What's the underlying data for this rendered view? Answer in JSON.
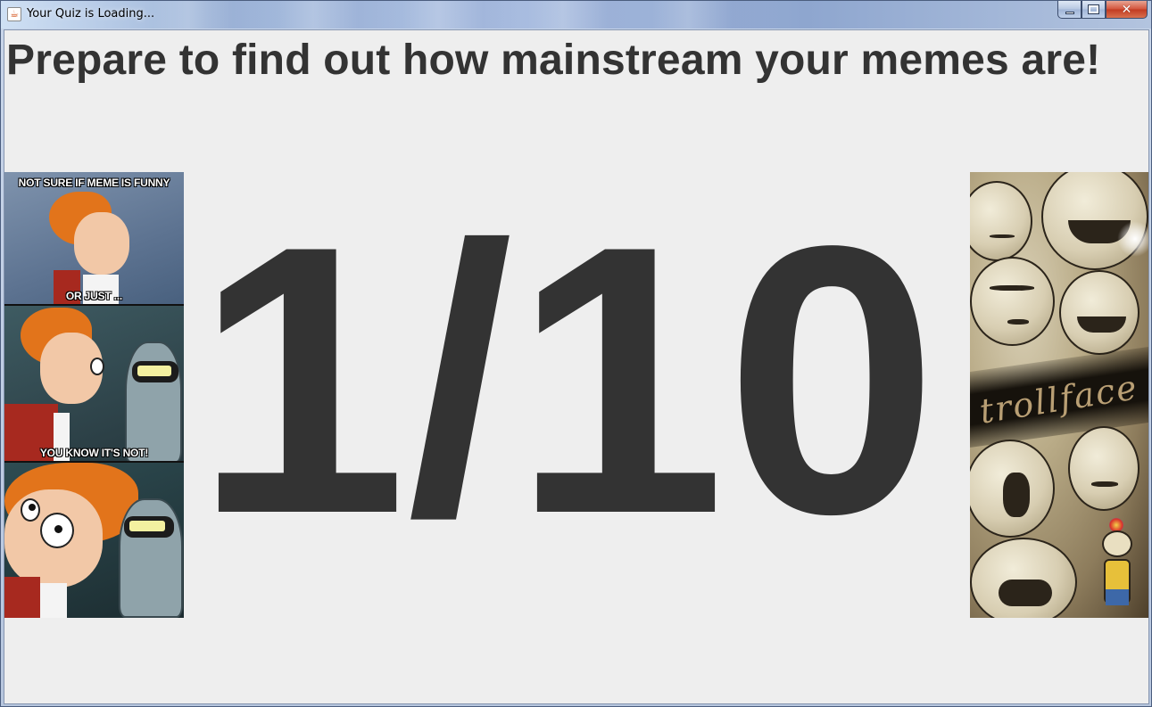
{
  "window": {
    "title": "Your Quiz is Loading...",
    "app_icon": "java-cup-icon",
    "controls": [
      "minimize-icon",
      "maximize-icon",
      "close-icon"
    ]
  },
  "main": {
    "headline": "Prepare to find out how mainstream your memes are!",
    "counter": "1/10"
  },
  "images": {
    "left_meme": {
      "caption_top": "NOT SURE IF MEME IS FUNNY",
      "caption_middle": "OR JUST ...",
      "caption_bottom": "YOU KNOW IT'S NOT!"
    },
    "right_meme": {
      "caption": "trollface"
    }
  },
  "colors": {
    "background": "#eeeeee",
    "text": "#333333"
  }
}
